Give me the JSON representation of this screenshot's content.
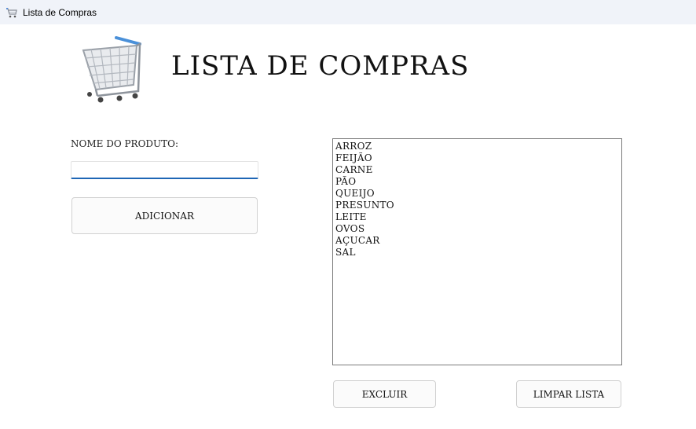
{
  "window": {
    "title": "Lista de Compras",
    "icon": "shopping-cart-icon"
  },
  "header": {
    "logo_icon": "shopping-cart-icon",
    "title": "LISTA DE COMPRAS"
  },
  "form": {
    "product_label": "NOME DO PRODUTO:",
    "product_value": "",
    "add_button": "ADICIONAR"
  },
  "list": {
    "items": [
      "ARROZ",
      "FEIJÃO",
      "CARNE",
      "PÃO",
      "QUEIJO",
      "PRESUNTO",
      "LEITE",
      "OVOS",
      "AÇUCAR",
      "SAL"
    ]
  },
  "actions": {
    "delete_button": "EXCLUIR",
    "clear_button": "LIMPAR LISTA"
  },
  "colors": {
    "input_accent": "#1e66b5",
    "titlebar_bg": "#f0f3f9"
  }
}
